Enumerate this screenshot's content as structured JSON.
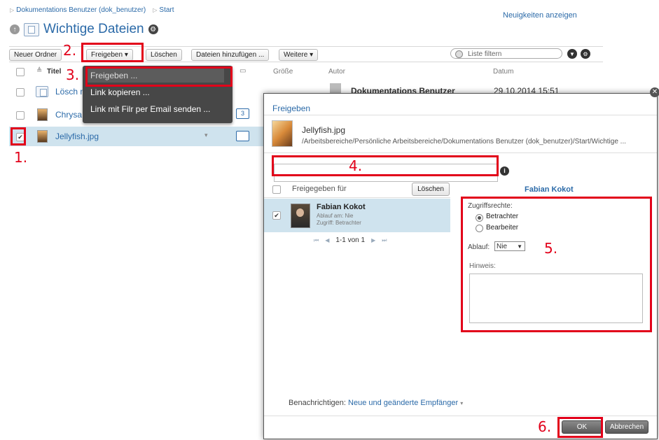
{
  "breadcrumb": [
    "Dokumentations Benutzer (dok_benutzer)",
    "Start"
  ],
  "news_link": "Neuigkeiten anzeigen",
  "page_title": "Wichtige Dateien",
  "toolbar": {
    "new_folder": "Neuer Ordner",
    "share": "Freigeben",
    "delete": "Löschen",
    "add_files": "Dateien hinzufügen ...",
    "more": "Weitere",
    "filter_placeholder": "Liste filtern"
  },
  "columns": {
    "title": "Titel",
    "size": "Größe",
    "author": "Autor",
    "date": "Datum"
  },
  "files": [
    {
      "name": "Lösch n",
      "author": "Dokumentations Benutzer",
      "date": "29.10.2014 15:51"
    },
    {
      "name": "Chrysa",
      "comments": "3"
    },
    {
      "name": "Jellyfish.jpg"
    }
  ],
  "share_menu": [
    "Freigeben ...",
    "Link kopieren ...",
    "Link mit Filr per Email senden ..."
  ],
  "dialog": {
    "title": "Freigeben",
    "file_name": "Jellyfish.jpg",
    "file_path": "/Arbeitsbereiche/Persönliche Arbeitsbereiche/Dokumentations Benutzer (dok_benutzer)/Start/Wichtige ...",
    "shared_with_header": "Freigegeben für",
    "delete_button": "Löschen",
    "selected_user": "Fabian Kokot",
    "recipient": {
      "name": "Fabian Kokot",
      "expiry": "Ablauf am: Nie",
      "access": "Zugriff: Betrachter"
    },
    "pager": "1-1 von 1",
    "access_rights_label": "Zugriffsrechte:",
    "access_options": [
      "Betrachter",
      "Bearbeiter"
    ],
    "expiry_label": "Ablauf:",
    "expiry_value": "Nie",
    "note_label": "Hinweis:",
    "notify_label": "Benachrichtigen:",
    "notify_value": "Neue und geänderte Empfänger",
    "ok_button": "OK",
    "cancel_button": "Abbrechen"
  },
  "step_labels": [
    "1.",
    "2.",
    "3.",
    "4.",
    "5.",
    "6."
  ],
  "colors": {
    "link_blue": "#2b6aa8",
    "annotation_red": "#e2001a",
    "selected_row": "#cfe3ee",
    "menu_bg": "#474747"
  }
}
